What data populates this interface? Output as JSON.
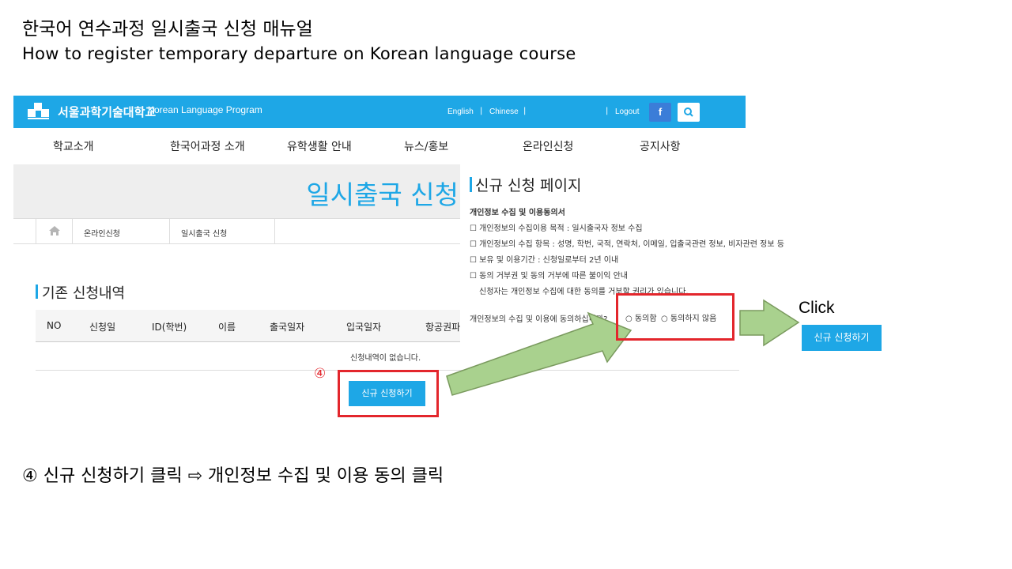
{
  "slide": {
    "title": "한국어 연수과정 일시출국 신청 매뉴얼",
    "subtitle": "How to register temporary departure on Korean language course",
    "caption": "④ 신규 신청하기 클릭 ⇨ 개인정보 수집 및 이용 동의 클릭"
  },
  "site": {
    "logo_text": "서울과학기술대학교",
    "logo_subtext": "Korean Language Program",
    "top_links": {
      "english": "English",
      "chinese": "Chinese",
      "logout": "Logout"
    },
    "separator": "|",
    "facebook_label": "f",
    "nav": [
      "학교소개",
      "한국어과정 소개",
      "유학생활 안내",
      "뉴스/홍보",
      "온라인신청",
      "공지사항"
    ],
    "banner_title": "일시출국 신청",
    "breadcrumb": [
      "온라인신청",
      "일시출국 신청"
    ],
    "section_title": "기존 신청내역",
    "table_headers": [
      "NO",
      "신청일",
      "ID(학번)",
      "이름",
      "출국일자",
      "입국일자",
      "항공권파"
    ],
    "empty_message": "신청내역이 없습니다.",
    "new_button": "신규 신청하기"
  },
  "popup": {
    "title": "신규 신청 페이지",
    "heading": "개인정보 수집 및 이용동의서",
    "lines": [
      "☐ 개인정보의 수집이용 목적 : 일시출국자 정보 수집",
      "☐ 개인정보의 수집 항목 : 성명, 학번, 국적, 연락처, 이메일, 입출국관련 정보, 비자관련 정보 등",
      "☐ 보유 및 이용기간 : 신청일로부터 2년 이내",
      "☐ 동의 거부권 및 동의 거부에 따른 불이익 안내",
      "  신청자는 개인정보 수집에 대한 동의를 거부할 권리가 있습니다."
    ],
    "question": "개인정보의 수집 및 이용에 동의하십니까?",
    "agree_label": "동의함",
    "disagree_label": "동의하지 않음",
    "radio_symbol": "○"
  },
  "annotations": {
    "step_number": "④",
    "click_label": "Click",
    "new_button_right": "신규 신청하기",
    "highlight_color": "#e3262c",
    "arrow_color": "#a9d18e",
    "accent_color": "#1ea7e6"
  }
}
